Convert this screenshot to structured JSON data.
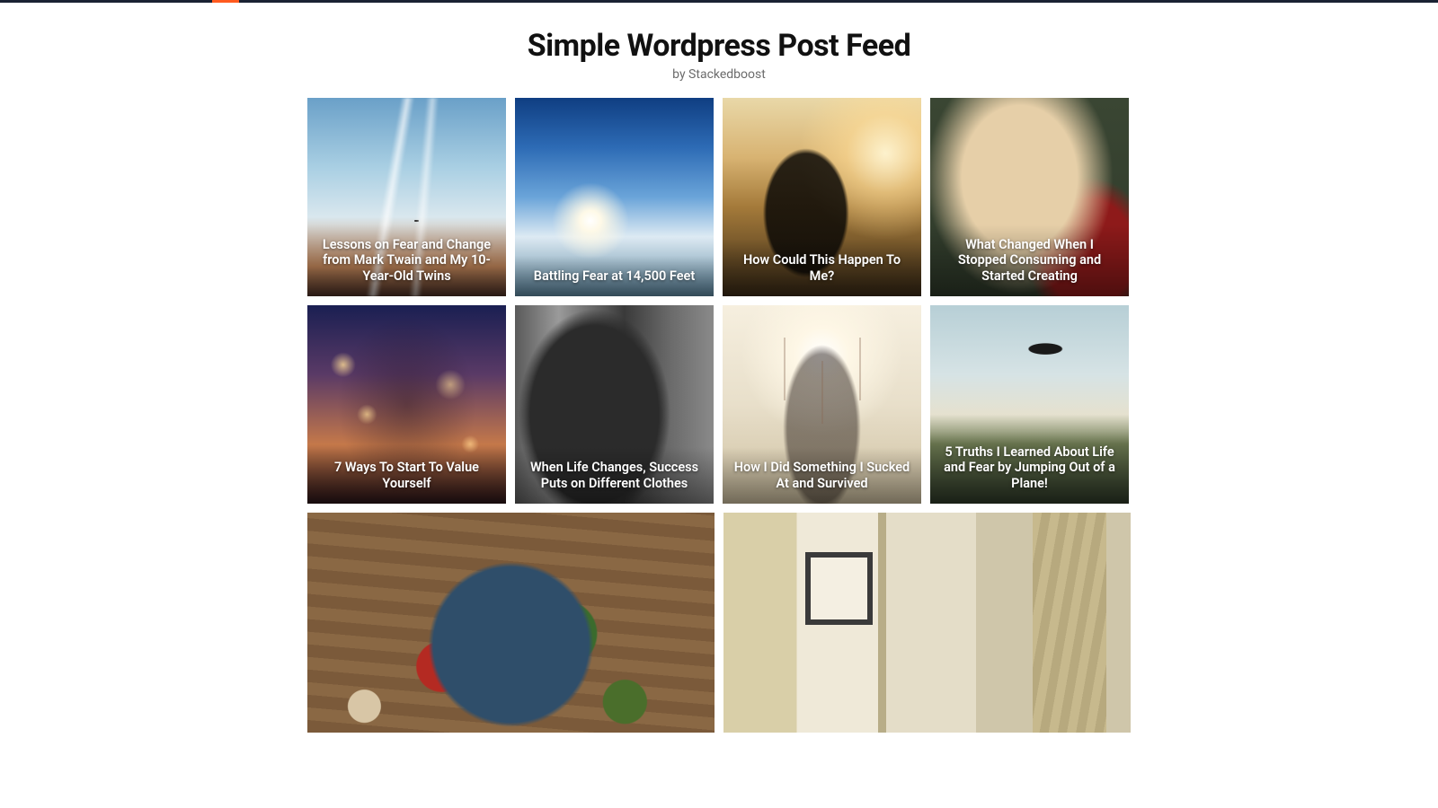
{
  "header": {
    "title": "Simple Wordpress Post Feed",
    "byline": "by Stackedboost"
  },
  "posts": [
    {
      "title": "Lessons on Fear and Change from Mark Twain and My 10-Year-Old Twins",
      "image": "plane"
    },
    {
      "title": "Battling Fear at 14,500 Feet",
      "image": "sunflare"
    },
    {
      "title": "How Could This Happen To Me?",
      "image": "sunset-field"
    },
    {
      "title": "What Changed When I Stopped Consuming and Started Creating",
      "image": "guitar"
    },
    {
      "title": "7 Ways To Start To Value Yourself",
      "image": "bokeh"
    },
    {
      "title": "When Life Changes, Success Puts on Different Clothes",
      "image": "bw-room"
    },
    {
      "title": "How I Did Something I Sucked At and Survived",
      "image": "arms"
    },
    {
      "title": "5 Truths I Learned About Life and Fear by Jumping Out of a Plane!",
      "image": "paraglide"
    }
  ],
  "wide_posts": [
    {
      "title": "",
      "image": "salad"
    },
    {
      "title": "",
      "image": "interior"
    }
  ]
}
